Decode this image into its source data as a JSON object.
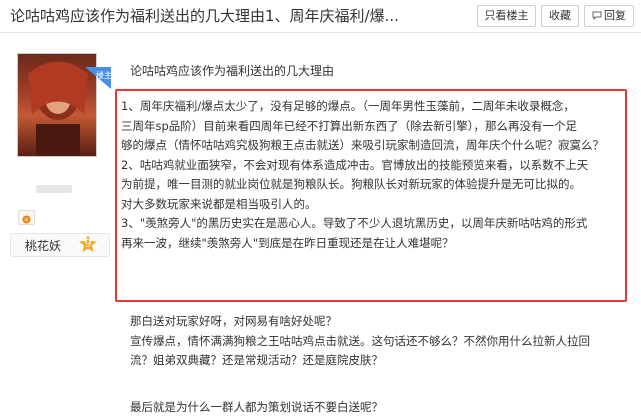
{
  "header": {
    "title": "论咕咕鸡应该作为福利送出的几大理由1、周年庆福利/爆...",
    "only_op_label": "只看楼主",
    "favorite_label": "收藏",
    "reply_label": "回复"
  },
  "sidebar": {
    "op_badge": "楼主",
    "level_name": "桃花妖",
    "level_number": "9"
  },
  "post": {
    "subtitle": "论咕咕鸡应该作为福利送出的几大理由",
    "highlighted_lines": [
      "1、周年庆福利/爆点太少了，没有足够的爆点。（一周年男性玉藻前，二周年未收录概念，",
      "三周年sp品阶）目前来看四周年已经不打算出新东西了（除去新引擎），那么再没有一个足",
      "够的爆点（情怀咕咕鸡究极狗粮王点击就送）来吸引玩家制造回流，周年庆个什么呢？寂寞么？",
      "2、咕咕鸡就业面狭窄，不会对现有体系造成冲击。官博放出的技能预览来看，以系数不上天",
      "为前提，唯一目测的就业岗位就是狗粮队长。狗粮队长对新玩家的体验提升是无可比拟的。",
      "对大多数玩家来说都是相当吸引人的。",
      "3、\"羡煞旁人\"的黑历史实在是恶心人。导致了不少人退坑黑历史，以周年庆新咕咕鸡的形式",
      "再来一波，继续\"羡煞旁人\"到底是在昨日重现还是在让人难堪呢？"
    ],
    "para1_lines": [
      "那白送对玩家好呀，对网易有啥好处呢？",
      "宣传爆点，情怀满满狗粮之王咕咕鸡点击就送。这句话还不够么？不然你用什么拉新人拉回",
      "流？姐弟双典藏？还是常规活动？还是庭院皮肤？"
    ],
    "para2_line": "最后就是为什么一群人都为策划说话不要白送呢？"
  },
  "colors": {
    "highlight_border": "#e53935",
    "op_badge_bg": "#4a90e2",
    "level_badge": "#f5a623"
  }
}
